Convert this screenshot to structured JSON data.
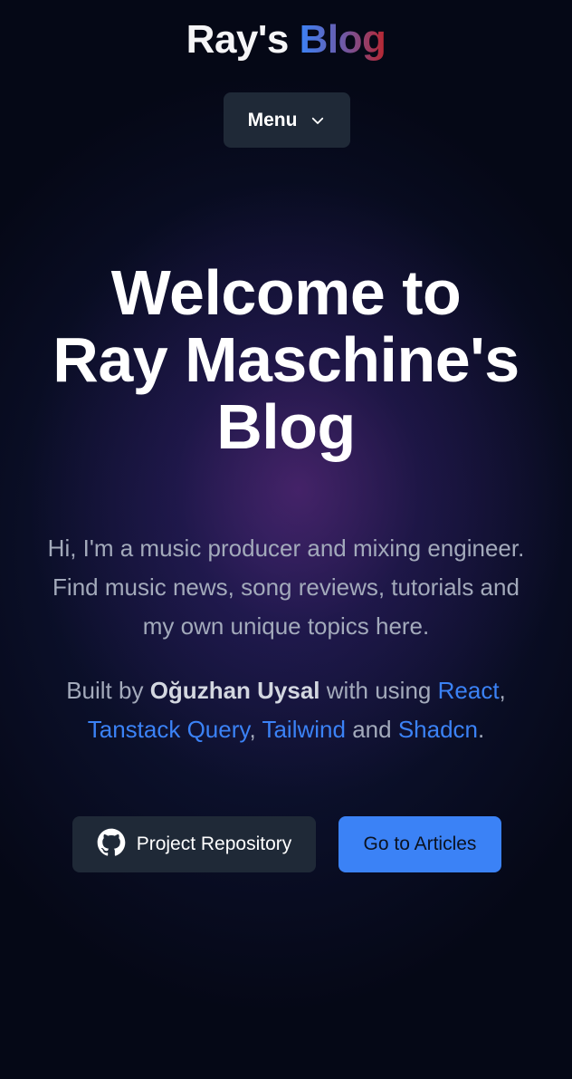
{
  "header": {
    "title_part1": "Ray's",
    "title_part2": "Blog",
    "menu_label": "Menu",
    "menu_icon": "chevron-down-icon"
  },
  "hero": {
    "title_line1": "Welcome to",
    "title_line2": "Ray Maschine's",
    "title_line3": "Blog",
    "description": "Hi, I'm a music producer and mixing engineer. Find music news, song reviews, tutorials and my own unique topics here."
  },
  "credits": {
    "prefix": "Built by",
    "author": "Oğuzhan Uysal",
    "middle": "with using",
    "tech1": "React",
    "sep1": ",",
    "tech2": "Tanstack Query",
    "sep2": ",",
    "tech3": "Tailwind",
    "and": "and",
    "tech4": "Shadcn",
    "end": "."
  },
  "actions": {
    "repo_label": "Project Repository",
    "repo_icon": "github-icon",
    "articles_label": "Go to Articles"
  },
  "colors": {
    "background": "#050816",
    "accent": "#3b82f6",
    "button_dark": "#1f2937",
    "text_muted": "#a3aabb"
  }
}
